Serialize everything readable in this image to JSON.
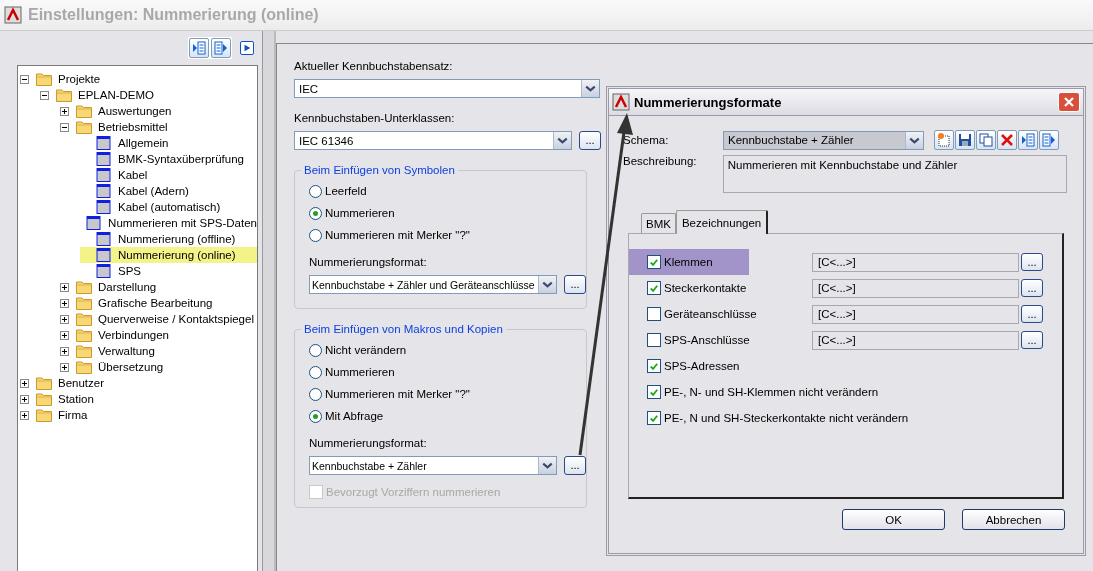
{
  "window": {
    "title": "Einstellungen: Nummerierung (online)"
  },
  "tree": [
    {
      "label": "Projekte",
      "kind": "folder",
      "expanded": true,
      "selected": false,
      "children": [
        {
          "label": "EPLAN-DEMO",
          "kind": "folder",
          "expanded": true,
          "selected": false,
          "children": [
            {
              "label": "Auswertungen",
              "kind": "folder",
              "expanded": false,
              "selected": false
            },
            {
              "label": "Betriebsmittel",
              "kind": "folder",
              "expanded": true,
              "selected": false,
              "children": [
                {
                  "label": "Allgemein",
                  "kind": "page",
                  "selected": false
                },
                {
                  "label": "BMK-Syntaxüberprüfung",
                  "kind": "page",
                  "selected": false
                },
                {
                  "label": "Kabel",
                  "kind": "page",
                  "selected": false
                },
                {
                  "label": "Kabel (Adern)",
                  "kind": "page",
                  "selected": false
                },
                {
                  "label": "Kabel (automatisch)",
                  "kind": "page",
                  "selected": false
                },
                {
                  "label": "Nummerieren mit SPS-Daten",
                  "kind": "page",
                  "selected": false
                },
                {
                  "label": "Nummerierung (offline)",
                  "kind": "page",
                  "selected": false
                },
                {
                  "label": "Nummerierung (online)",
                  "kind": "page",
                  "selected": true
                },
                {
                  "label": "SPS",
                  "kind": "page",
                  "selected": false
                }
              ]
            },
            {
              "label": "Darstellung",
              "kind": "folder",
              "expanded": false,
              "selected": false
            },
            {
              "label": "Grafische Bearbeitung",
              "kind": "folder",
              "expanded": false,
              "selected": false
            },
            {
              "label": "Querverweise / Kontaktspiegel",
              "kind": "folder",
              "expanded": false,
              "selected": false
            },
            {
              "label": "Verbindungen",
              "kind": "folder",
              "expanded": false,
              "selected": false
            },
            {
              "label": "Verwaltung",
              "kind": "folder",
              "expanded": false,
              "selected": false
            },
            {
              "label": "Übersetzung",
              "kind": "folder",
              "expanded": false,
              "selected": false
            }
          ]
        }
      ]
    },
    {
      "label": "Benutzer",
      "kind": "folder",
      "expanded": false,
      "selected": false
    },
    {
      "label": "Station",
      "kind": "folder",
      "expanded": false,
      "selected": false
    },
    {
      "label": "Firma",
      "kind": "folder",
      "expanded": false,
      "selected": false
    }
  ],
  "settings": {
    "letter_set": {
      "label": "Aktueller Kennbuchstabensatz:",
      "value": "IEC"
    },
    "subclasses": {
      "label": "Kennbuchstaben-Unterklassen:",
      "value": "IEC 61346",
      "button": "..."
    },
    "groups": [
      {
        "title": "Beim Einfügen von Symbolen",
        "options": [
          {
            "label": "Leerfeld",
            "selected": false
          },
          {
            "label": "Nummerieren",
            "selected": true
          },
          {
            "label": "Nummerieren mit Merker \"?\"",
            "selected": false
          }
        ],
        "format_label": "Nummerierungsformat:",
        "format_value": "Kennbuchstabe + Zähler und Geräteanschlüsse",
        "button": "..."
      },
      {
        "title": "Beim Einfügen von Makros und Kopien",
        "options": [
          {
            "label": "Nicht verändern",
            "selected": false
          },
          {
            "label": "Nummerieren",
            "selected": false
          },
          {
            "label": "Nummerieren mit Merker \"?\"",
            "selected": false
          },
          {
            "label": "Mit Abfrage",
            "selected": true
          }
        ],
        "format_label": "Nummerierungsformat:",
        "format_value": "Kennbuchstabe + Zähler",
        "button": "...",
        "checkbox": {
          "label": "Bevorzugt Vorziffern nummerieren",
          "checked": false,
          "disabled": true
        }
      }
    ]
  },
  "dialog": {
    "title": "Nummerierungsformate",
    "schema": {
      "label": "Schema:",
      "value": "Kennbuchstabe + Zähler"
    },
    "description": {
      "label": "Beschreibung:",
      "value": "Nummerieren mit Kennbuchstabe und Zähler"
    },
    "tabs": [
      {
        "label": "BMK",
        "selected": false
      },
      {
        "label": "Bezeichnungen",
        "selected": true
      }
    ],
    "rows": [
      {
        "kind": "field",
        "label": "Klemmen",
        "checked": true,
        "highlighted": true,
        "value": "[C<...>]",
        "button": "..."
      },
      {
        "kind": "field",
        "label": "Steckerkontakte",
        "checked": true,
        "highlighted": false,
        "value": "[C<...>]",
        "button": "..."
      },
      {
        "kind": "field",
        "label": "Geräteanschlüsse",
        "checked": false,
        "highlighted": false,
        "value": "[C<...>]",
        "button": "..."
      },
      {
        "kind": "field",
        "label": "SPS-Anschlüsse",
        "checked": false,
        "highlighted": false,
        "value": "[C<...>]",
        "button": "..."
      },
      {
        "kind": "check",
        "label": "SPS-Adressen",
        "checked": true,
        "highlighted": false
      },
      {
        "kind": "check",
        "label": "PE-, N- und SH-Klemmen nicht verändern",
        "checked": true,
        "highlighted": false
      },
      {
        "kind": "check",
        "label": "PE-, N und SH-Steckerkontakte nicht verändern",
        "checked": true,
        "highlighted": false
      }
    ],
    "buttons": [
      "OK",
      "Abbrechen"
    ]
  }
}
